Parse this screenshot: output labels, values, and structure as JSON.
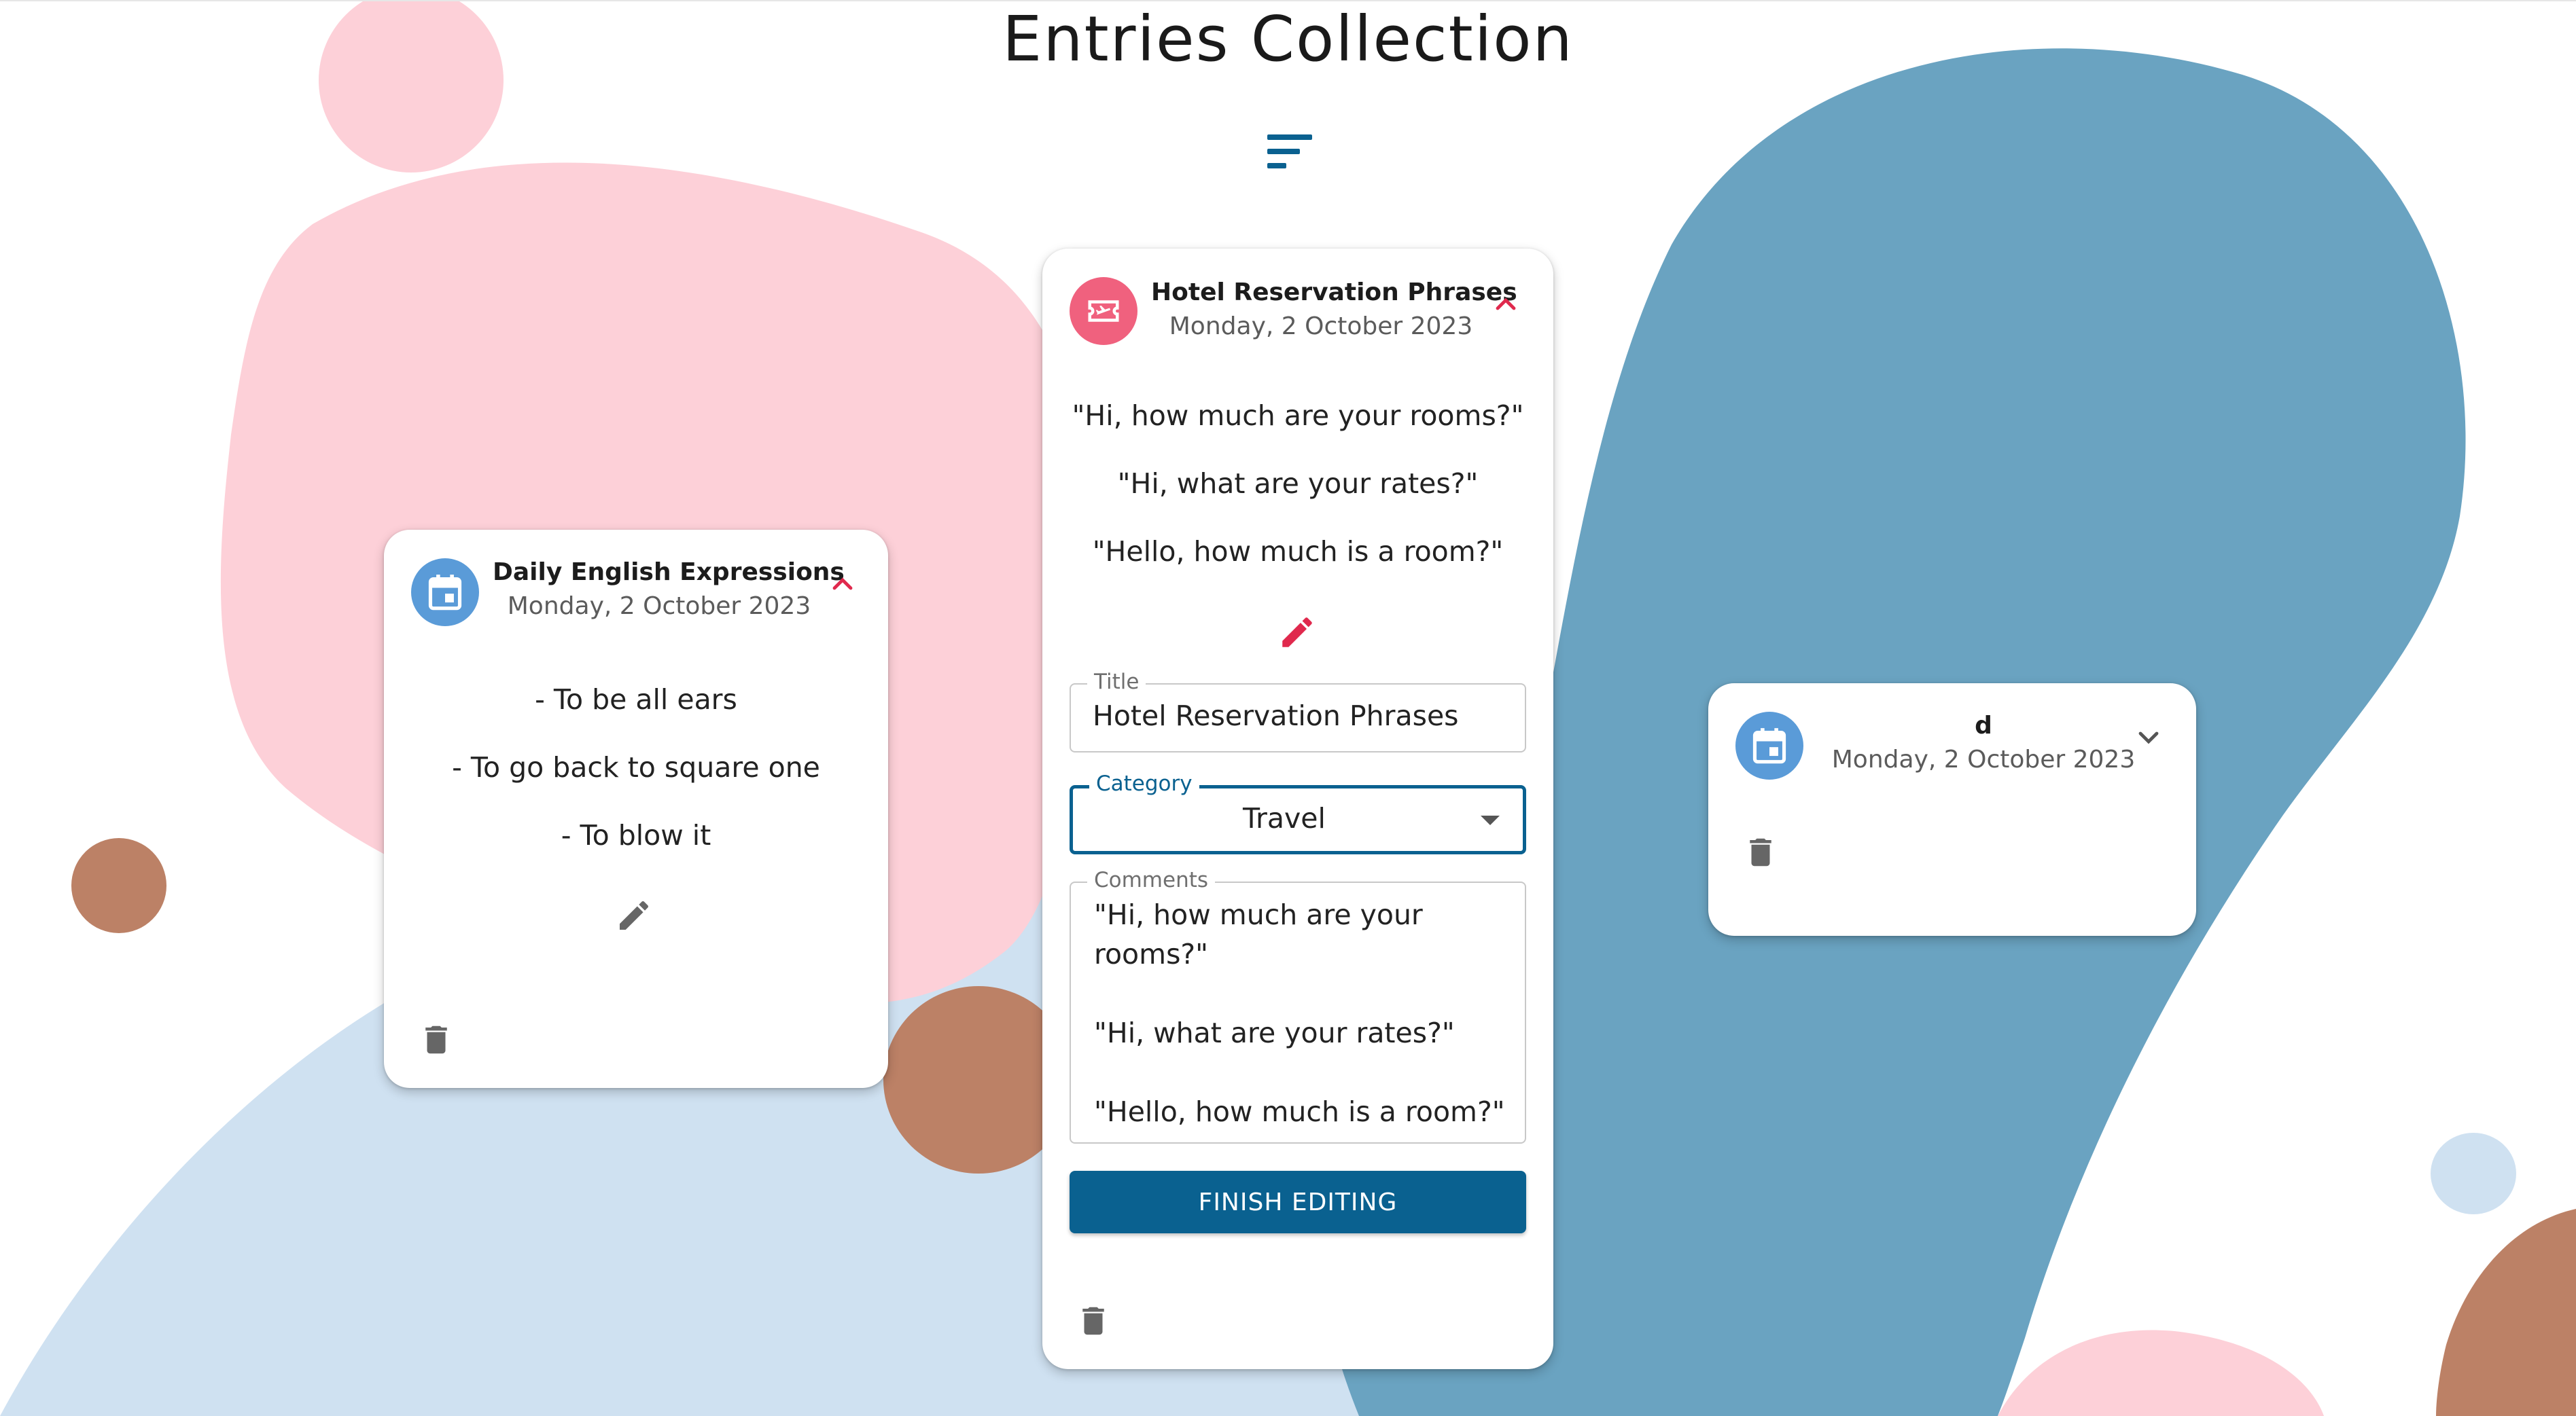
{
  "page": {
    "title": "Entries Collection"
  },
  "toolbar": {
    "sort_icon": "sort-icon"
  },
  "colors": {
    "accent": "#0a6190",
    "pink_blob": "#fdd0d8",
    "teal_blob": "#6aa3c1",
    "light_blue_blob": "#cfe1f1",
    "brown_blob": "#bc8166",
    "category_icon_blue": "#5a9bd8",
    "category_icon_pink": "#f0617e",
    "expand_chevron": "#e0294d"
  },
  "entries": [
    {
      "title": "Daily English Expressions",
      "date": "Monday, 2 October 2023",
      "icon": "calendar-icon",
      "expanded": true,
      "lines": [
        "- To be all ears",
        "- To go back to square one",
        "- To blow it"
      ]
    },
    {
      "title": "Hotel Reservation Phrases",
      "date": "Monday, 2 October 2023",
      "icon": "plane-ticket-icon",
      "expanded": true,
      "editing": true,
      "lines": [
        "\"Hi, how much are your rooms?\"",
        "\"Hi, what are your rates?\"",
        "\"Hello, how much is a room?\""
      ],
      "form": {
        "title_label": "Title",
        "title_value": "Hotel Reservation Phrases",
        "category_label": "Category",
        "category_value": "Travel",
        "comments_label": "Comments",
        "comments_value": "\"Hi, how much are your rooms?\"\n\n\"Hi, what are your rates?\"\n\n\"Hello, how much is a room?\"",
        "finish_label": "FINISH EDITING"
      }
    },
    {
      "title": "d",
      "date": "Monday, 2 October 2023",
      "icon": "calendar-icon",
      "expanded": false
    }
  ]
}
